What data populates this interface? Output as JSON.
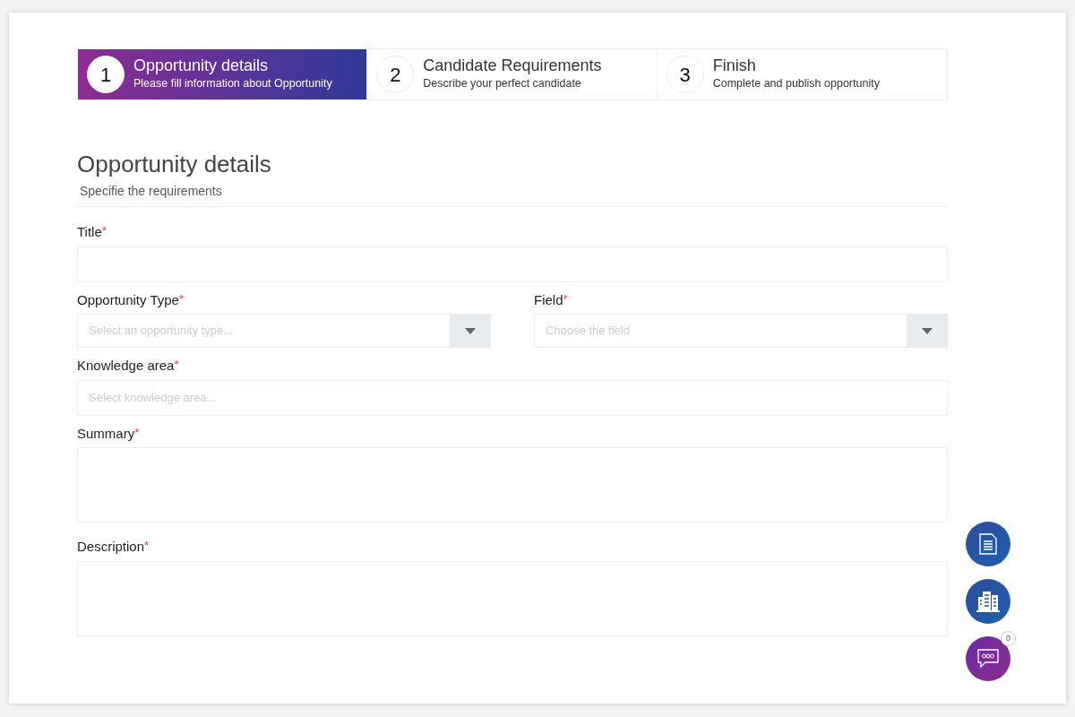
{
  "steps": [
    {
      "number": "1",
      "title": "Opportunity details",
      "subtitle": "Please fill information about Opportunity",
      "selected": true
    },
    {
      "number": "2",
      "title": "Candidate Requirements",
      "subtitle": "Describe your perfect candidate",
      "selected": false
    },
    {
      "number": "3",
      "title": "Finish",
      "subtitle": "Complete and publish opportunity",
      "selected": false
    }
  ],
  "section": {
    "title": "Opportunity details",
    "subtitle": "Specifie the requirements"
  },
  "form_rows": [
    [
      {
        "kind": "text",
        "label": "Title",
        "required_mark": "*"
      }
    ],
    [
      {
        "kind": "select",
        "label": "Opportunity Type",
        "required_mark": "*",
        "placeholder": "Select an opportunity type..."
      },
      {
        "kind": "select",
        "label": "Field",
        "required_mark": "*",
        "placeholder": "Choose the field"
      }
    ],
    [
      {
        "kind": "text",
        "label": "Knowledge area",
        "required_mark": "*",
        "placeholder": "Select knowledge area..."
      }
    ],
    [
      {
        "kind": "textarea",
        "label": "Summary",
        "required_mark": "*"
      }
    ],
    [
      {
        "kind": "textarea",
        "label": "Description",
        "required_mark": "*"
      }
    ]
  ],
  "floating_buttons": [
    {
      "kind": "document"
    },
    {
      "kind": "building"
    },
    {
      "kind": "chat",
      "badge": "0"
    }
  ]
}
